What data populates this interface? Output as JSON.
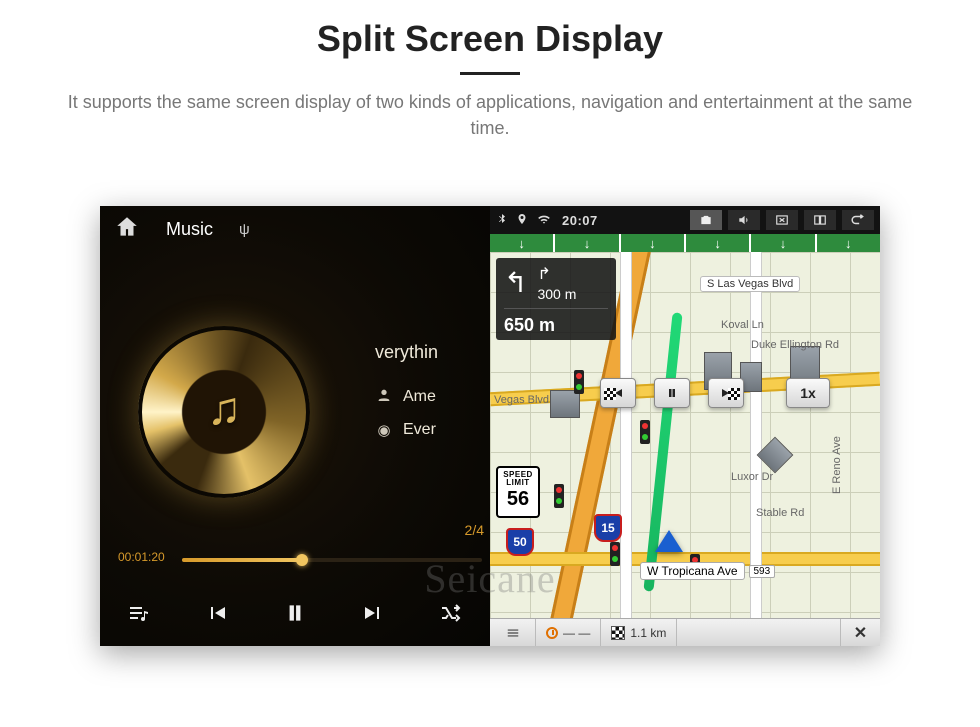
{
  "page": {
    "title": "Split Screen Display",
    "description": "It supports the same screen display of two kinds of applications, navigation and entertainment at the same time."
  },
  "music": {
    "app_label": "Music",
    "usb_symbol": "ψ",
    "song_title": "verythin",
    "artist": "Ame",
    "album": "Ever",
    "track_counter": "2/4",
    "elapsed": "00:01:20"
  },
  "status": {
    "clock": "20:07"
  },
  "turn": {
    "next_dist": "300 m",
    "current_dist": "650 m"
  },
  "streets": {
    "vegas": "S Las Vegas Blvd",
    "koval": "Koval Ln",
    "duke": "Duke Ellington Rd",
    "luxor": "Luxor Dr",
    "stable": "Stable Rd",
    "reno": "E Reno Ave",
    "trop": "W Tropicana Ave",
    "trop_num": "593",
    "vegas_short": "Vegas Blvd"
  },
  "speed": {
    "label": "SPEED LIMIT",
    "value": "56"
  },
  "shields": {
    "a": "50",
    "b": "15"
  },
  "sim": {
    "speed": "1x"
  },
  "bottom": {
    "remaining_dist": "1.1 km"
  },
  "watermark": "Seicane"
}
